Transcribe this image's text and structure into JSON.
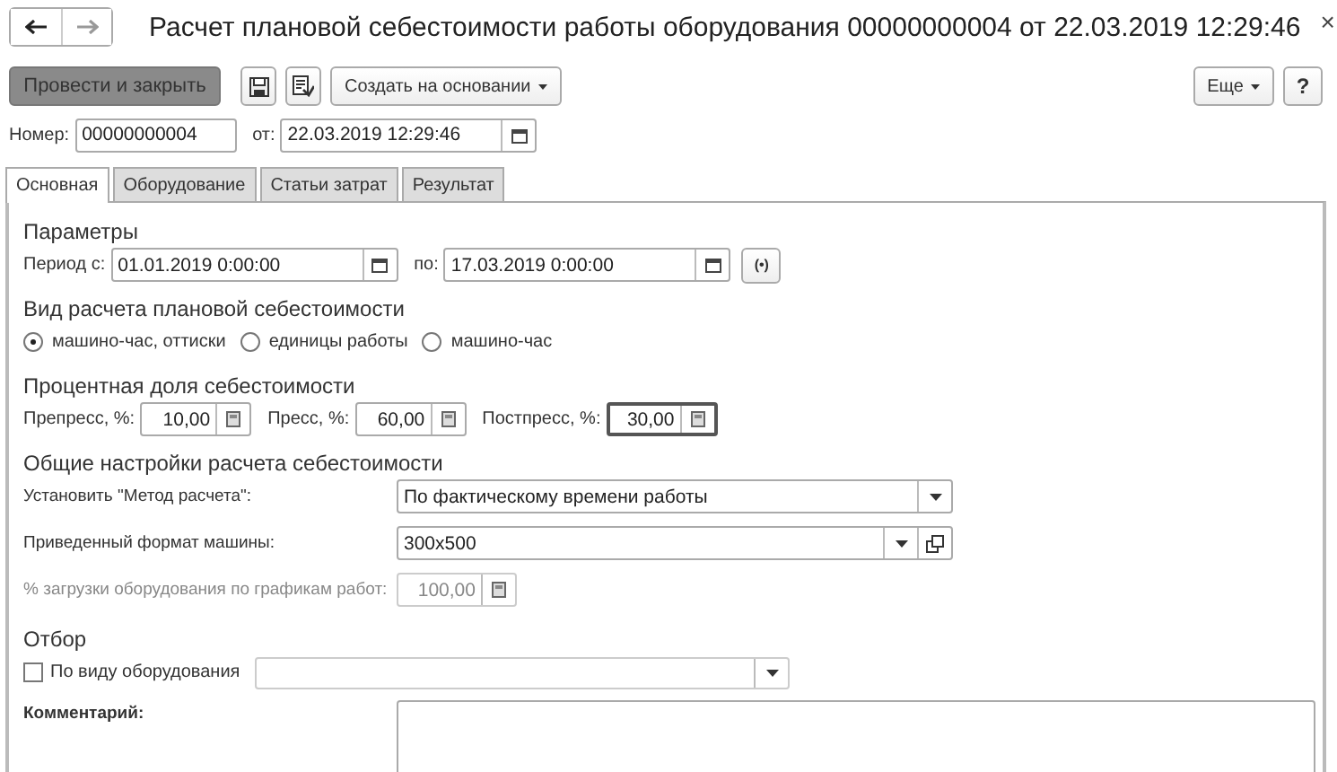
{
  "window": {
    "title": "Расчет плановой себестоимости работы оборудования 00000000004 от 22.03.2019 12:29:46",
    "close": "×"
  },
  "toolbar": {
    "post_button": "Провести и закрыть",
    "create_button": "Создать на основании",
    "more_button": "Еще",
    "help_button": "?"
  },
  "header": {
    "number_label": "Номер:",
    "number": "00000000004",
    "date_label": "от:",
    "date": "22.03.2019 12:29:46"
  },
  "tabs": [
    {
      "label": "Основная",
      "selected": true
    },
    {
      "label": "Оборудование",
      "selected": false
    },
    {
      "label": "Статьи затрат",
      "selected": false
    },
    {
      "label": "Результат",
      "selected": false
    }
  ],
  "parameters": {
    "heading": "Параметры",
    "from_label": "Период с:",
    "from": "01.01.2019  0:00:00",
    "to_label": "по:",
    "to": "17.03.2019  0:00:00",
    "period_button": "(•)"
  },
  "calc_type": {
    "heading": "Вид расчета плановой себестоимости",
    "options": [
      {
        "label": "машино-час, оттиски",
        "selected": true
      },
      {
        "label": "единицы работы",
        "selected": false
      },
      {
        "label": "машино-час",
        "selected": false
      }
    ]
  },
  "share": {
    "heading": "Процентная доля себестоимости",
    "fields": [
      {
        "label": "Препресс, %:",
        "value": "10,00",
        "focused": false
      },
      {
        "label": "Пресс, %:",
        "value": "60,00",
        "focused": false
      },
      {
        "label": "Постпресс, %:",
        "value": "30,00",
        "focused": true
      }
    ]
  },
  "settings": {
    "heading": "Общие настройки расчета себестоимости",
    "method_label": "Установить \"Метод расчета\":",
    "method": "По фактическому времени работы",
    "format_label": "Приведенный формат машины:",
    "format": "300x500",
    "load_label": "% загрузки оборудования по графикам работ:",
    "load": "100,00",
    "load_disabled": true
  },
  "filter": {
    "heading": "Отбор",
    "by_type_label": "По виду оборудования",
    "by_type_checked": false,
    "comment_label": "Комментарий:"
  }
}
